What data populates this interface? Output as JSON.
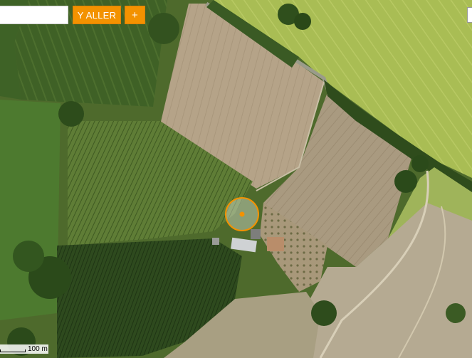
{
  "map": {
    "type": "satellite",
    "colors": {
      "field_green_light": "#a4b84e",
      "field_green_dark": "#4a6a2a",
      "plowed_field": "#b7a588",
      "forest": "#2c4a1c",
      "marker_orange": "#f39200"
    }
  },
  "search": {
    "value": "",
    "placeholder": "",
    "go_label": "Y ALLER",
    "plus_label": "+"
  },
  "scale_bar": {
    "label": "100 m"
  }
}
